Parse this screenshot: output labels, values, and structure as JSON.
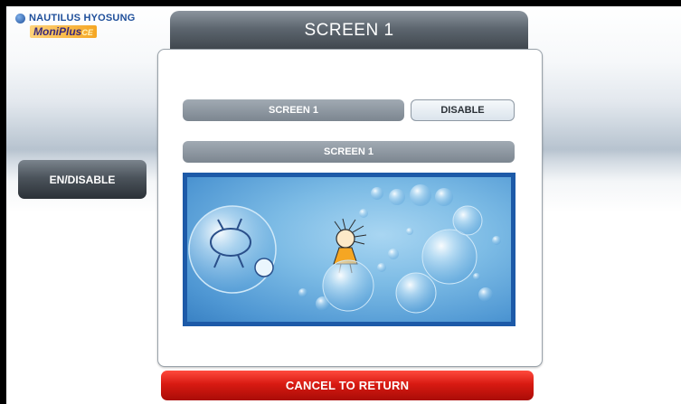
{
  "logo": {
    "brand": "NAUTILUS HYOSUNG",
    "product_part1": "Moni",
    "product_part2": "Plus",
    "product_suffix": "CE"
  },
  "header": {
    "title": "SCREEN 1"
  },
  "sidebar": {
    "endisable_label": "EN/DISABLE"
  },
  "main": {
    "screen_field": "SCREEN 1",
    "disable_label": "DISABLE",
    "preview_label": "SCREEN 1"
  },
  "footer": {
    "cancel_label": "CANCEL TO RETURN"
  },
  "colors": {
    "header_gray": "#5d666f",
    "cancel_red": "#d81a12",
    "preview_border": "#1d5aa8"
  }
}
